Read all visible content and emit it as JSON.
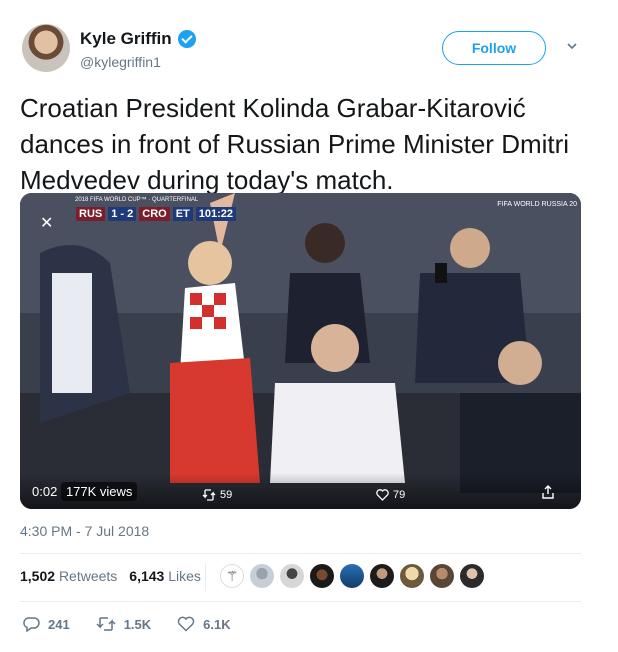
{
  "author": {
    "name": "Kyle Griffin",
    "handle": "@kylegriffin1",
    "verified_icon": "verified-badge-icon"
  },
  "follow_label": "Follow",
  "tweet_text": "Croatian President Kolinda Grabar-Kitarović dances in front of Russian Prime Minister Dmitri Medvedev during today's match.",
  "video": {
    "scoreboard_title": "2018 FIFA WORLD CUP™ · QUARTERFINAL",
    "team1": "RUS",
    "score": "1 - 2",
    "team2": "CRO",
    "extra": "ET",
    "clock": "101:22",
    "logo_text": "FIFA WORLD RUSSIA 20",
    "elapsed": "0:02",
    "views": "177K views",
    "retweets": "59",
    "likes": "79"
  },
  "timestamp": "4:30 PM - 7 Jul 2018",
  "stats": {
    "retweets_count": "1,502",
    "retweets_label": "Retweets",
    "likes_count": "6,143",
    "likes_label": "Likes"
  },
  "actions": {
    "reply_count": "241",
    "retweet_count": "1.5K",
    "like_count": "6.1K"
  },
  "colors": {
    "accent": "#1da1f2",
    "text": "#14171a",
    "muted": "#657786"
  }
}
